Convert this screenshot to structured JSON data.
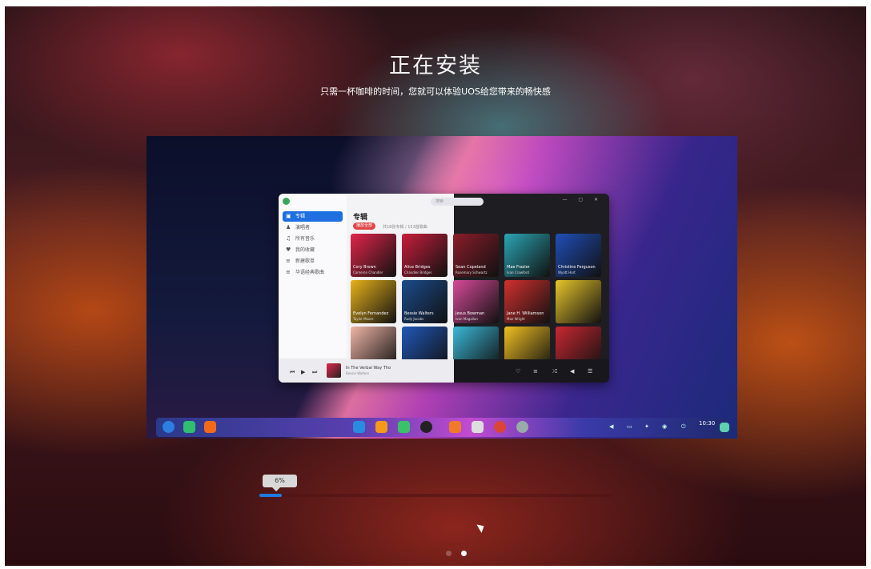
{
  "installer": {
    "title": "正在安装",
    "subtitle": "只需一杯咖啡的时间，您就可以体验UOS给您带来的畅快感",
    "progress": {
      "percent": 0.06,
      "label": "6%"
    },
    "slides": {
      "count": 2,
      "active": 1
    }
  },
  "preview": {
    "music_app": {
      "search_placeholder": "搜索",
      "heading": "专辑",
      "play_all_label": "播放全部",
      "song_count": "共18张专辑 / 153首歌曲",
      "sidebar": [
        {
          "label": "专辑",
          "icon": "album-icon",
          "active": true
        },
        {
          "label": "演唱者",
          "icon": "artist-icon"
        },
        {
          "label": "所有音乐",
          "icon": "music-note-icon"
        },
        {
          "label": "我的收藏",
          "icon": "heart-icon"
        },
        {
          "label": "新建歌单",
          "icon": "playlist-icon"
        },
        {
          "label": "华语经典歌曲",
          "icon": "playlist-icon"
        }
      ],
      "albums": [
        {
          "name": "Cory Brown",
          "artist": "Cameron Chandler",
          "color": "#e2264a"
        },
        {
          "name": "Alice Bridges",
          "artist": "Chandler Bridges",
          "color": "#c81e3c"
        },
        {
          "name": "Sean Copeland",
          "artist": "Rosemary Schwartz",
          "color": "#8a1d2a"
        },
        {
          "name": "Mae Frazier",
          "artist": "Ivan Crawford",
          "color": "#2aa6b4"
        },
        {
          "name": "Christine Ferguson",
          "artist": "Wyatt Hart",
          "color": "#1f4fb8"
        },
        {
          "name": "Evelyn Fernandez",
          "artist": "Taylor Moore",
          "color": "#e7b21a"
        },
        {
          "name": "Bessie Walters",
          "artist": "Rudy Jacobs",
          "color": "#1b4c8c"
        },
        {
          "name": "Jesus Bowman",
          "artist": "Ivan Magallan",
          "color": "#d84a9a"
        },
        {
          "name": "Jane H. Williamson",
          "artist": "Mae Wright",
          "color": "#d2302e"
        },
        {
          "name": "",
          "artist": "",
          "color": "#e7c52a"
        },
        {
          "name": "",
          "artist": "",
          "color": "#f0b6a6"
        },
        {
          "name": "",
          "artist": "",
          "color": "#2058b8"
        },
        {
          "name": "",
          "artist": "",
          "color": "#3ab8d8"
        },
        {
          "name": "",
          "artist": "",
          "color": "#f0c020"
        },
        {
          "name": "",
          "artist": "",
          "color": "#c82832"
        }
      ],
      "now_playing": {
        "title": "In The Verbal Way Tho",
        "artist": "Bessie Walters"
      }
    },
    "dock": {
      "apps": [
        {
          "icon": "launcher-icon",
          "color": "#2a7fe0"
        },
        {
          "icon": "multitask-icon",
          "color": "#2fbf6e"
        },
        {
          "icon": "desktop-icon",
          "color": "#f06a1a"
        },
        {
          "icon": "file-manager-icon",
          "color": "#2a8ce0"
        },
        {
          "icon": "app-store-icon",
          "color": "#f29a1a"
        },
        {
          "icon": "music-icon",
          "color": "#3ac26a"
        },
        {
          "icon": "video-icon",
          "color": "#222"
        },
        {
          "icon": "photos-icon",
          "color": "#f07a2a"
        },
        {
          "icon": "camera-icon",
          "color": "#ddd"
        },
        {
          "icon": "browser-icon",
          "color": "#db4437"
        },
        {
          "icon": "settings-icon",
          "color": "#9aa"
        }
      ],
      "clock": "10:30"
    }
  }
}
